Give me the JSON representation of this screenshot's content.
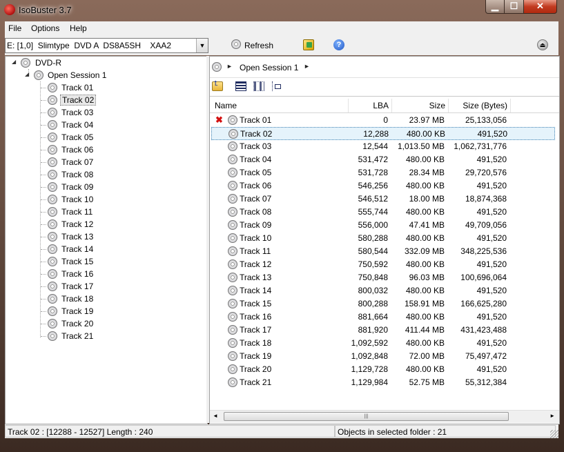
{
  "window": {
    "title": "IsoBuster 3.7",
    "minimize_glyph": "▁",
    "maximize_glyph": "☐",
    "close_glyph": "✕"
  },
  "menu": [
    "File",
    "Options",
    "Help"
  ],
  "toolbar": {
    "drive": "E: [1,0]  Slimtype  DVD A  DS8A5SH    XAA2",
    "refresh_label": "Refresh",
    "help_glyph": "?",
    "eject_glyph": "⏏"
  },
  "tree": {
    "root": "DVD-R",
    "session": "Open Session 1",
    "tracks": [
      "Track 01",
      "Track 02",
      "Track 03",
      "Track 04",
      "Track 05",
      "Track 06",
      "Track 07",
      "Track 08",
      "Track 09",
      "Track 10",
      "Track 11",
      "Track 12",
      "Track 13",
      "Track 14",
      "Track 15",
      "Track 16",
      "Track 17",
      "Track 18",
      "Track 19",
      "Track 20",
      "Track 21"
    ],
    "selected_track_index": 1
  },
  "path": {
    "current": "Open Session 1"
  },
  "list": {
    "columns": [
      "Name",
      "LBA",
      "Size",
      "Size (Bytes)"
    ],
    "rows": [
      {
        "name": "Track 01",
        "lba": "0",
        "size": "23.97 MB",
        "bytes": "25,133,056",
        "error": true
      },
      {
        "name": "Track 02",
        "lba": "12,288",
        "size": "480.00 KB",
        "bytes": "491,520",
        "selected": true
      },
      {
        "name": "Track 03",
        "lba": "12,544",
        "size": "1,013.50 MB",
        "bytes": "1,062,731,776"
      },
      {
        "name": "Track 04",
        "lba": "531,472",
        "size": "480.00 KB",
        "bytes": "491,520"
      },
      {
        "name": "Track 05",
        "lba": "531,728",
        "size": "28.34 MB",
        "bytes": "29,720,576"
      },
      {
        "name": "Track 06",
        "lba": "546,256",
        "size": "480.00 KB",
        "bytes": "491,520"
      },
      {
        "name": "Track 07",
        "lba": "546,512",
        "size": "18.00 MB",
        "bytes": "18,874,368"
      },
      {
        "name": "Track 08",
        "lba": "555,744",
        "size": "480.00 KB",
        "bytes": "491,520"
      },
      {
        "name": "Track 09",
        "lba": "556,000",
        "size": "47.41 MB",
        "bytes": "49,709,056"
      },
      {
        "name": "Track 10",
        "lba": "580,288",
        "size": "480.00 KB",
        "bytes": "491,520"
      },
      {
        "name": "Track 11",
        "lba": "580,544",
        "size": "332.09 MB",
        "bytes": "348,225,536"
      },
      {
        "name": "Track 12",
        "lba": "750,592",
        "size": "480.00 KB",
        "bytes": "491,520"
      },
      {
        "name": "Track 13",
        "lba": "750,848",
        "size": "96.03 MB",
        "bytes": "100,696,064"
      },
      {
        "name": "Track 14",
        "lba": "800,032",
        "size": "480.00 KB",
        "bytes": "491,520"
      },
      {
        "name": "Track 15",
        "lba": "800,288",
        "size": "158.91 MB",
        "bytes": "166,625,280"
      },
      {
        "name": "Track 16",
        "lba": "881,664",
        "size": "480.00 KB",
        "bytes": "491,520"
      },
      {
        "name": "Track 17",
        "lba": "881,920",
        "size": "411.44 MB",
        "bytes": "431,423,488"
      },
      {
        "name": "Track 18",
        "lba": "1,092,592",
        "size": "480.00 KB",
        "bytes": "491,520"
      },
      {
        "name": "Track 19",
        "lba": "1,092,848",
        "size": "72.00 MB",
        "bytes": "75,497,472"
      },
      {
        "name": "Track 20",
        "lba": "1,129,728",
        "size": "480.00 KB",
        "bytes": "491,520"
      },
      {
        "name": "Track 21",
        "lba": "1,129,984",
        "size": "52.75 MB",
        "bytes": "55,312,384"
      }
    ],
    "error_glyph": "✖"
  },
  "status": {
    "left": "Track 02 : [12288 - 12527]  Length : 240",
    "right": "Objects in selected folder : 21"
  },
  "colors": {
    "selection": "#e5f3fb",
    "error": "#d31010",
    "frame": "#5d3c2f"
  }
}
